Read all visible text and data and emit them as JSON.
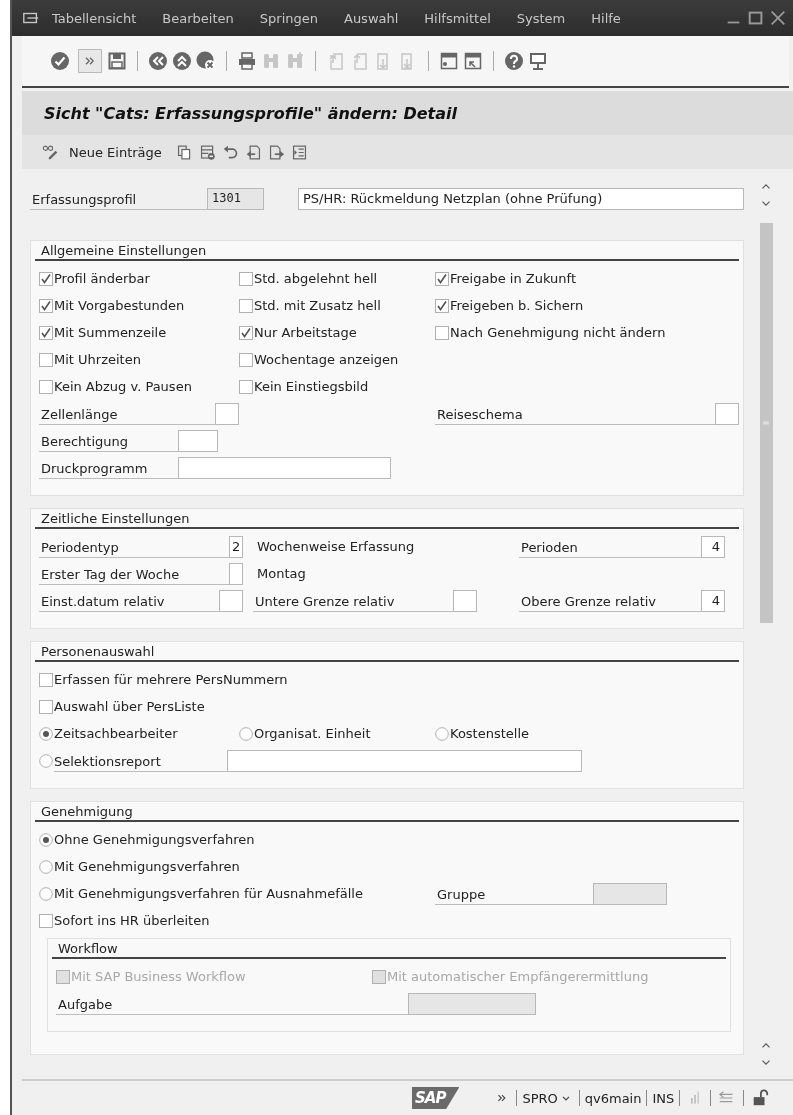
{
  "window": {
    "menu": [
      "Tabellensicht",
      "Bearbeiten",
      "Springen",
      "Auswahl",
      "Hilfsmittel",
      "System",
      "Hilfe"
    ]
  },
  "toolbar": [
    [
      {
        "kind": "enter",
        "disabled": false
      },
      {
        "kind": "more",
        "disabled": false
      },
      {
        "kind": "save",
        "disabled": false
      }
    ],
    [
      {
        "kind": "back",
        "disabled": false
      },
      {
        "kind": "exit",
        "disabled": false
      },
      {
        "kind": "cancel",
        "disabled": false
      }
    ],
    [
      {
        "kind": "print",
        "disabled": false
      },
      {
        "kind": "find",
        "disabled": true
      },
      {
        "kind": "find-next",
        "disabled": true
      }
    ],
    [
      {
        "kind": "first-page",
        "disabled": true
      },
      {
        "kind": "previous-page",
        "disabled": true
      },
      {
        "kind": "next-page",
        "disabled": true
      },
      {
        "kind": "last-page",
        "disabled": true
      }
    ],
    [
      {
        "kind": "layout",
        "disabled": false
      },
      {
        "kind": "shortcut",
        "disabled": false
      }
    ],
    [
      {
        "kind": "help",
        "disabled": false
      },
      {
        "kind": "monitor",
        "disabled": false
      }
    ]
  ],
  "title": "Sicht \"Cats: Erfassungsprofile\" ändern: Detail",
  "app_toolbar": [
    {
      "kind": "display-change"
    },
    {
      "kind": "new-entries",
      "label": "Neue Einträge"
    },
    {
      "kind": "copy"
    },
    {
      "kind": "delete"
    },
    {
      "kind": "undo"
    },
    {
      "kind": "previous"
    },
    {
      "kind": "next"
    },
    {
      "kind": "select-block"
    }
  ],
  "header": {
    "label": "Erfassungsprofil",
    "value": "1301",
    "description": "PS/HR: Rückmeldung Netzplan (ohne Prüfung)"
  },
  "groups": [
    {
      "title": "Allgemeine Einstellungen",
      "rows": [
        {
          "left": {
            "kind": "checkbox",
            "label": "Profil änderbar",
            "checked": true,
            "disabled": false
          },
          "middle": {
            "kind": "checkbox",
            "label": "Std. abgelehnt hell",
            "checked": false,
            "disabled": false
          },
          "right": {
            "kind": "checkbox",
            "label": "Freigabe in Zukunft",
            "checked": true,
            "disabled": false
          }
        },
        {
          "left": {
            "kind": "checkbox",
            "label": "Mit Vorgabestunden",
            "checked": true,
            "disabled": false
          },
          "middle": {
            "kind": "checkbox",
            "label": "Std. mit Zusatz hell",
            "checked": false,
            "disabled": false
          },
          "right": {
            "kind": "checkbox",
            "label": "Freigeben b. Sichern",
            "checked": true,
            "disabled": false
          }
        },
        {
          "left": {
            "kind": "checkbox",
            "label": "Mit Summenzeile",
            "checked": true,
            "disabled": false
          },
          "middle": {
            "kind": "checkbox",
            "label": "Nur Arbeitstage",
            "checked": true,
            "disabled": false
          },
          "right": {
            "kind": "checkbox",
            "label": "Nach Genehmigung nicht ändern",
            "checked": false,
            "disabled": false
          }
        },
        {
          "left": {
            "kind": "checkbox",
            "label": "Mit Uhrzeiten",
            "checked": false,
            "disabled": false
          },
          "middle": {
            "kind": "checkbox",
            "label": "Wochentage anzeigen",
            "checked": false,
            "disabled": false
          }
        },
        {
          "left": {
            "kind": "checkbox",
            "label": "Kein Abzug v. Pausen",
            "checked": false,
            "disabled": false
          },
          "middle": {
            "kind": "checkbox",
            "label": "Kein Einstiegsbild",
            "checked": false,
            "disabled": false
          }
        },
        {
          "left": {
            "kind": "field",
            "label": "Zellenlänge",
            "disabled": false
          },
          "right": {
            "kind": "field",
            "label": "Reiseschema",
            "disabled": false
          }
        },
        {
          "left": {
            "kind": "field",
            "label": "Berechtigung",
            "disabled": false
          }
        },
        {
          "left": {
            "kind": "field",
            "label": "Druckprogramm",
            "disabled": false
          }
        }
      ]
    },
    {
      "title": "Zeitliche Einstellungen",
      "rows": [
        {
          "left": {
            "kind": "field",
            "label": "Periodentyp",
            "value": "2",
            "disabled": false
          },
          "middle": {
            "kind": "text",
            "label": "Wochenweise Erfassung"
          },
          "right": {
            "kind": "field",
            "label": "Perioden",
            "value": "4",
            "disabled": false
          }
        },
        {
          "left": {
            "kind": "field",
            "label": "Erster Tag der Woche",
            "disabled": false
          },
          "middle": {
            "kind": "text",
            "label": "Montag"
          }
        },
        {
          "left": {
            "kind": "field",
            "label": "Einst.datum relativ",
            "disabled": false
          },
          "middle": {
            "kind": "field",
            "label": "Untere Grenze relativ",
            "disabled": false
          },
          "right": {
            "kind": "field",
            "label": "Obere Grenze relativ",
            "value": "4",
            "disabled": false
          }
        }
      ]
    },
    {
      "title": "Personenauswahl",
      "rows": [
        {
          "left": {
            "kind": "checkbox",
            "label": "Erfassen für mehrere PersNummern",
            "checked": false,
            "disabled": false
          }
        },
        {
          "left": {
            "kind": "checkbox",
            "label": "Auswahl über PersListe",
            "checked": false,
            "disabled": false
          }
        },
        {
          "left": {
            "kind": "radio",
            "label": "Zeitsachbearbeiter",
            "selected": true
          },
          "middle": {
            "kind": "radio",
            "label": "Organisat. Einheit",
            "selected": false
          },
          "right": {
            "kind": "radio",
            "label": "Kostenstelle",
            "selected": false
          }
        },
        {
          "left": {
            "kind": "radio",
            "label": "Selektionsreport",
            "selected": false,
            "input": {
              "disabled": false
            }
          }
        }
      ]
    },
    {
      "title": "Genehmigung",
      "rows": [
        {
          "left": {
            "kind": "radio",
            "label": "Ohne Genehmigungsverfahren",
            "selected": true
          }
        },
        {
          "left": {
            "kind": "radio",
            "label": "Mit Genehmigungsverfahren",
            "selected": false
          }
        },
        {
          "left": {
            "kind": "radio",
            "label": "Mit Genehmigungsverfahren für Ausnahmefälle",
            "selected": false
          },
          "right": {
            "kind": "field",
            "label": "Gruppe",
            "disabled": true
          }
        },
        {
          "left": {
            "kind": "checkbox",
            "label": "Sofort ins HR überleiten",
            "checked": false,
            "disabled": false
          }
        }
      ],
      "subgroup": {
        "title": "Workflow",
        "rows": [
          {
            "left": {
              "kind": "checkbox",
              "label": "Mit SAP Business Workflow",
              "checked": false,
              "disabled": true
            },
            "right": {
              "kind": "checkbox",
              "label": "Mit automatischer Empfängerermittlung",
              "checked": false,
              "disabled": true
            }
          },
          {
            "left": {
              "kind": "field",
              "label": "Aufgabe",
              "disabled": true
            }
          }
        ]
      }
    }
  ],
  "status_bar": {
    "logo": "SAP",
    "transaction": "SPRO",
    "system": "qv6main",
    "mode": "INS"
  }
}
